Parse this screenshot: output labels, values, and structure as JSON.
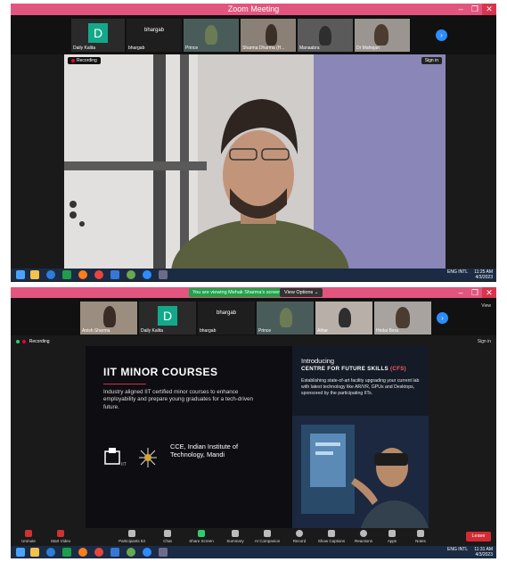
{
  "window1": {
    "title": "Zoom Meeting",
    "controls": [
      "–",
      "❐",
      "✕"
    ],
    "thumbnails": [
      {
        "name": "Daily Kalita",
        "initial": "D"
      },
      {
        "name": "bhargab",
        "label": "bhargab"
      },
      {
        "name": "Prince"
      },
      {
        "name": "Sharma Dharma (H..."
      },
      {
        "name": "Manaabra"
      },
      {
        "name": "Dr Mahejan"
      }
    ],
    "next_arrow": "›",
    "recording_label": "Recording",
    "signin_label": "Sign in",
    "taskbar_time": "11:25 AM",
    "taskbar_date": "4/3/2023",
    "taskbar_lang": "ENG\nINTL"
  },
  "window2": {
    "share_notice": "You are viewing Mehak Sharma's screen",
    "view_options": "View Options ⌄",
    "top_right_label": "View",
    "recording_label": "Recording",
    "signin_label": "Sign in",
    "thumbnails": [
      {
        "name": "Anish Sharma"
      },
      {
        "name": "Daily Kalita",
        "initial": "D"
      },
      {
        "name": "bhargab",
        "label": "bhargab"
      },
      {
        "name": "Prince"
      },
      {
        "name": "Athar"
      },
      {
        "name": "Hridai Bora"
      }
    ],
    "slide": {
      "title": "IIT MINOR COURSES",
      "body": "Industry aligned IIT certified minor courses to enhance employability and prepare young graduates for a tech-driven future.",
      "org": "CCE, Indian Institute of Technology, Mandi",
      "right_intro": "Introducing",
      "right_title": "CENTRE FOR FUTURE SKILLS",
      "right_abbr": "(CFS)",
      "right_body": "Establishing state-of-art facility upgrading your current lab with latest technology like AR/VR, GPUs and Desktops, sponsored by the participating IITs."
    },
    "toolbar": [
      "Unmute",
      "Start Video",
      "Participants",
      "Chat",
      "Share Screen",
      "Summary",
      "AI Companion",
      "Record",
      "Show Captions",
      "Reactions",
      "Apps",
      "Notes"
    ],
    "participants_count": "53",
    "end_label": "Leave",
    "taskbar_time": "11:31 AM",
    "taskbar_date": "4/3/2023",
    "taskbar_lang": "ENG\nINTL"
  },
  "colors": {
    "titlebar": "#e2557e",
    "zoom_blue": "#2d8cff",
    "share_green": "#1fa34a",
    "end_red": "#d42a33",
    "accent_red": "#ff5a6e"
  }
}
